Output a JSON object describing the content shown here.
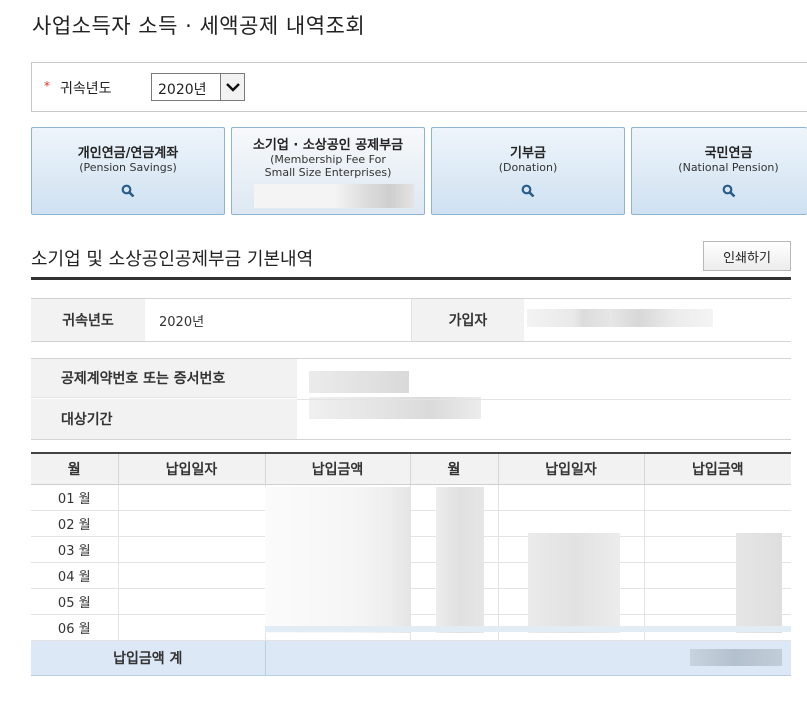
{
  "page": {
    "title": "사업소득자 소득 · 세액공제 내역조회"
  },
  "year_select": {
    "required_mark": "*",
    "label": "귀속년도",
    "value": "2020년"
  },
  "categories": [
    {
      "ko": "개인연금/연금계좌",
      "en1": "(Pension Savings)",
      "en2": ""
    },
    {
      "ko": "소기업 · 소상공인 공제부금",
      "en1": "(Membership Fee For",
      "en2": "Small Size Enterprises)"
    },
    {
      "ko": "기부금",
      "en1": "(Donation)",
      "en2": ""
    },
    {
      "ko": "국민연금",
      "en1": "(National Pension)",
      "en2": ""
    }
  ],
  "section": {
    "title": "소기업 및 소상공인공제부금 기본내역",
    "print_label": "인쇄하기"
  },
  "info": {
    "year_label": "귀속년도",
    "year_value": "2020년",
    "subscriber_label": "가입자",
    "contract_label": "공제계약번호 또는 증서번호",
    "period_label": "대상기간"
  },
  "monthly": {
    "headers": [
      "월",
      "납입일자",
      "납입금액",
      "월",
      "납입일자",
      "납입금액"
    ],
    "months": [
      "01 월",
      "02 월",
      "03 월",
      "04 월",
      "05 월",
      "06 월"
    ],
    "total_label": "납입금액 계"
  }
}
